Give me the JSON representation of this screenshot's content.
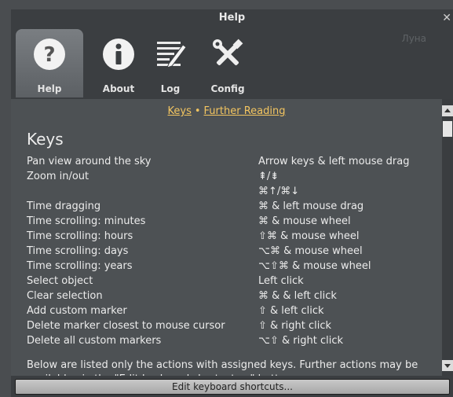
{
  "window": {
    "title": "Help",
    "close_glyph": "✕"
  },
  "toolbar": {
    "tabs": [
      {
        "label": "Help",
        "icon": "question-icon",
        "active": true
      },
      {
        "label": "About",
        "icon": "info-icon",
        "active": false
      },
      {
        "label": "Log",
        "icon": "log-pencil-icon",
        "active": false
      },
      {
        "label": "Config",
        "icon": "tools-icon",
        "active": false
      }
    ],
    "ghost_text": "Луна"
  },
  "content": {
    "links": {
      "keys": "Keys",
      "separator": "•",
      "further": "Further Reading"
    },
    "heading": "Keys",
    "rows": [
      {
        "action": "Pan view around the sky",
        "keys": "Arrow keys & left mouse drag"
      },
      {
        "action": "Zoom in/out",
        "keys": "⇞/⇟"
      },
      {
        "action": "",
        "keys": "⌘↑/⌘↓"
      },
      {
        "action": "Time dragging",
        "keys": "⌘ & left mouse drag"
      },
      {
        "action": "Time scrolling: minutes",
        "keys": "⌘ & mouse wheel"
      },
      {
        "action": "Time scrolling: hours",
        "keys": "⇧⌘ & mouse wheel"
      },
      {
        "action": "Time scrolling: days",
        "keys": "⌥⌘ & mouse wheel"
      },
      {
        "action": "Time scrolling: years",
        "keys": "⌥⇧⌘ & mouse wheel"
      },
      {
        "action": "Select object",
        "keys": "Left click"
      },
      {
        "action": "Clear selection",
        "keys": "⌘ & & left click"
      },
      {
        "action": "Add custom marker",
        "keys": "⇧ & left click"
      },
      {
        "action": "Delete marker closest to mouse cursor",
        "keys": "⇧ & right click"
      },
      {
        "action": "Delete all custom markers",
        "keys": "⌥⇧ & right click"
      }
    ],
    "note": "Below are listed only the actions with assigned keys. Further actions may be available via the \"Edit keyboard shortcuts...\" button."
  },
  "edit_button": {
    "label": "Edit keyboard shortcuts..."
  },
  "colors": {
    "link": "#f3c560",
    "background": "#4d5154",
    "toolbar": "#3b3e41"
  }
}
